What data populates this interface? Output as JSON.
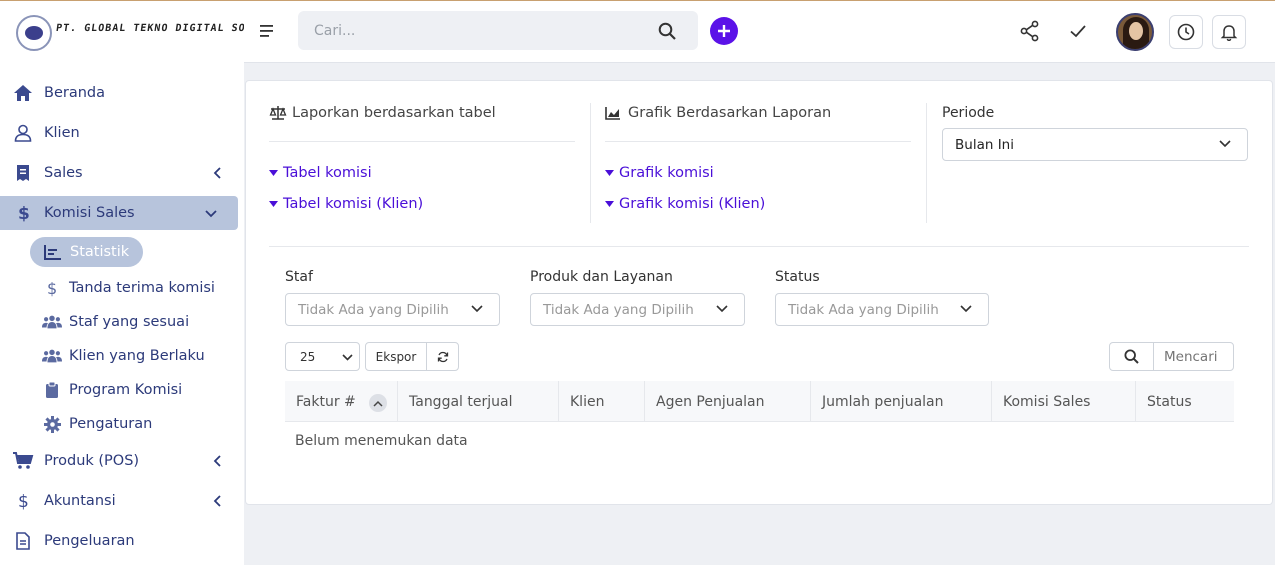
{
  "brand": {
    "name": "PT. GLOBAL TEKNO DIGITAL SOLUSI"
  },
  "sidebar": {
    "items": [
      {
        "label": "Beranda",
        "icon": "home-icon"
      },
      {
        "label": "Klien",
        "icon": "user-icon"
      },
      {
        "label": "Sales",
        "icon": "receipt-icon"
      },
      {
        "label": "Komisi Sales",
        "icon": "dollar-icon"
      }
    ],
    "subitems": [
      {
        "label": "Statistik",
        "icon": "chart-icon"
      },
      {
        "label": "Tanda terima komisi",
        "icon": "dollar-icon"
      },
      {
        "label": "Staf yang sesuai",
        "icon": "users-icon"
      },
      {
        "label": "Klien yang Berlaku",
        "icon": "users-icon"
      },
      {
        "label": "Program Komisi",
        "icon": "clipboard-icon"
      },
      {
        "label": "Pengaturan",
        "icon": "gear-icon"
      }
    ],
    "items_after": [
      {
        "label": "Produk (POS)",
        "icon": "cart-icon"
      },
      {
        "label": "Akuntansi",
        "icon": "dollar-icon"
      },
      {
        "label": "Pengeluaran",
        "icon": "document-icon"
      }
    ]
  },
  "header": {
    "search_placeholder": "Cari...",
    "accent": "#5b12e8"
  },
  "report": {
    "table_section": {
      "title": "Laporkan berdasarkan tabel",
      "links": [
        "Tabel komisi",
        "Tabel komisi (Klien)"
      ]
    },
    "chart_section": {
      "title": "Grafik Berdasarkan Laporan",
      "links": [
        "Grafik komisi",
        "Grafik komisi (Klien)"
      ]
    },
    "period": {
      "label": "Periode",
      "value": "Bulan Ini"
    }
  },
  "filters": {
    "staff": {
      "label": "Staf",
      "placeholder": "Tidak Ada yang Dipilih"
    },
    "product": {
      "label": "Produk dan Layanan",
      "placeholder": "Tidak Ada yang Dipilih"
    },
    "status": {
      "label": "Status",
      "placeholder": "Tidak Ada yang Dipilih"
    }
  },
  "table": {
    "page_size": "25",
    "export_label": "Ekspor",
    "search_placeholder": "Mencari",
    "columns": [
      "Faktur #",
      "Tanggal terjual",
      "Klien",
      "Agen Penjualan",
      "Jumlah penjualan",
      "Komisi Sales",
      "Status"
    ],
    "empty_text": "Belum menemukan data"
  }
}
